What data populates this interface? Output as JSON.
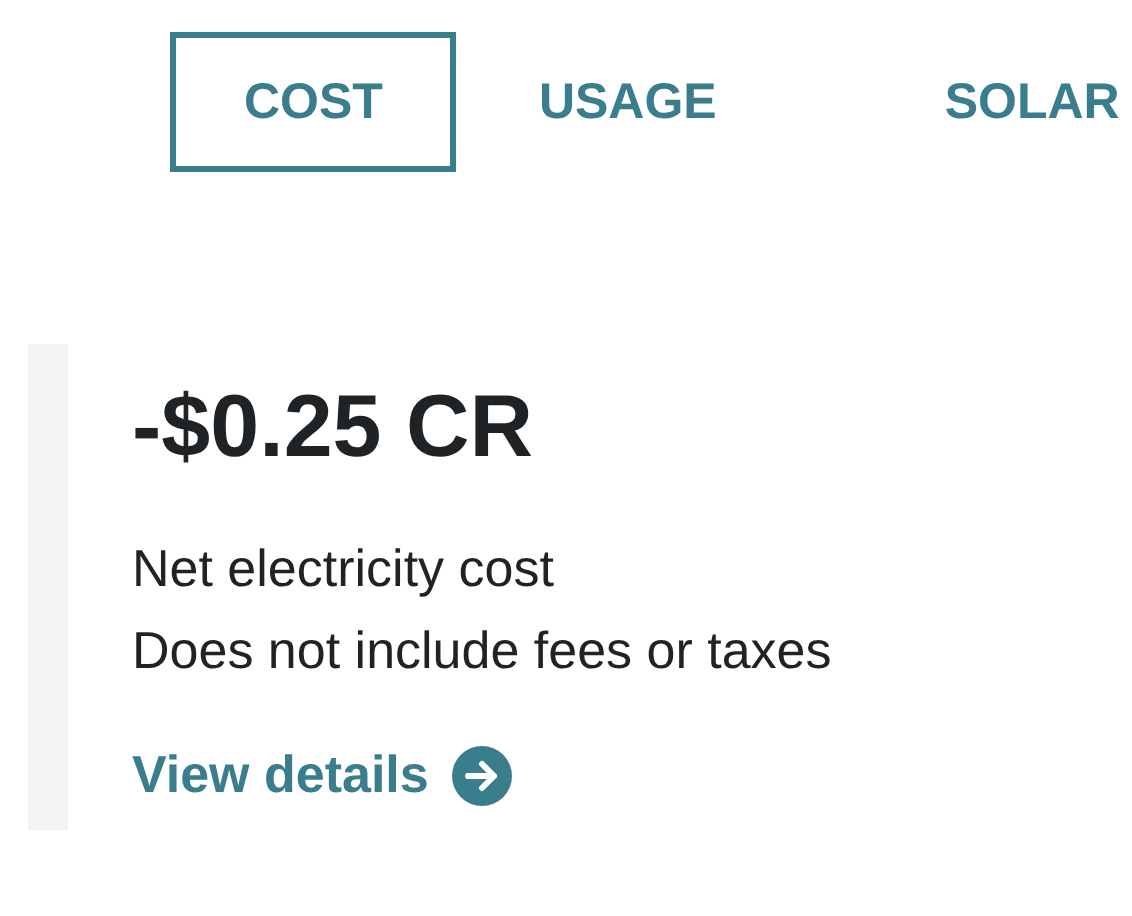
{
  "tabs": [
    {
      "label": "COST",
      "selected": true
    },
    {
      "label": "USAGE",
      "selected": false
    },
    {
      "label": "SOLAR",
      "selected": false
    }
  ],
  "summary": {
    "amount": "-$0.25 CR",
    "lines": [
      "Net electricity cost",
      "Does not include fees or taxes"
    ],
    "link": "View details"
  }
}
